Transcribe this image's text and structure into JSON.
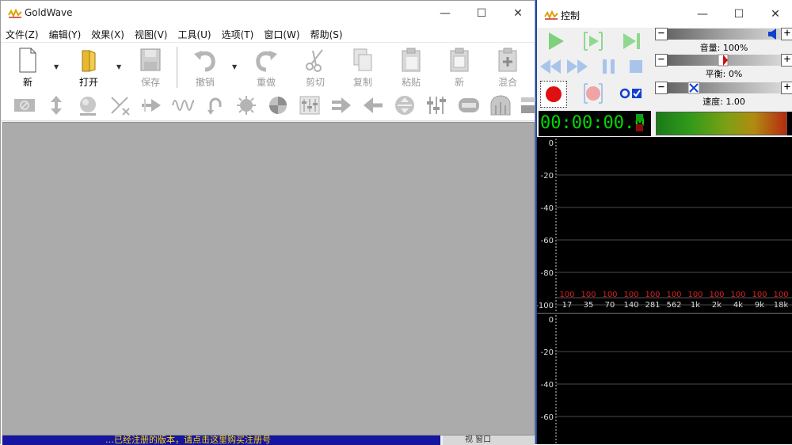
{
  "main": {
    "title": "GoldWave",
    "menu": [
      "文件(Z)",
      "编辑(Y)",
      "效果(X)",
      "视图(V)",
      "工具(U)",
      "选项(T)",
      "窗口(W)",
      "帮助(S)"
    ],
    "toolbar": {
      "new": "新",
      "open": "打开",
      "save": "保存",
      "undo": "撤销",
      "redo": "重做",
      "cut": "剪切",
      "copy": "复制",
      "paste": "粘贴",
      "paste_new": "新",
      "mix": "混合"
    },
    "status_message": "…已经注册的版本，请点击这里购买注册号",
    "status_right": "视  窗口"
  },
  "control": {
    "title": "控制",
    "volume_label": "音量: 100%",
    "balance_label": "平衡: 0%",
    "speed_label": "速度: 1.00",
    "time": "00:00:00.0",
    "spectrum": {
      "y_ticks": [
        "0",
        "-20",
        "-40",
        "-60",
        "-80",
        "-100"
      ],
      "x_ticks": [
        "17",
        "35",
        "70",
        "140",
        "281",
        "562",
        "1k",
        "2k",
        "4k",
        "9k",
        "18k"
      ],
      "peak_values": [
        "100",
        "100",
        "100",
        "100",
        "100",
        "100",
        "100",
        "100",
        "100",
        "100",
        "100"
      ]
    },
    "spectrum2_y_ticks": [
      "0",
      "-20",
      "-40",
      "-60"
    ],
    "levels": {
      "volume": 1.0,
      "balance": 0.0,
      "speed": 1.0
    },
    "colors": {
      "time_green": "#00d800",
      "peak_red": "#e02020",
      "play_green": "#7ed07e"
    }
  }
}
